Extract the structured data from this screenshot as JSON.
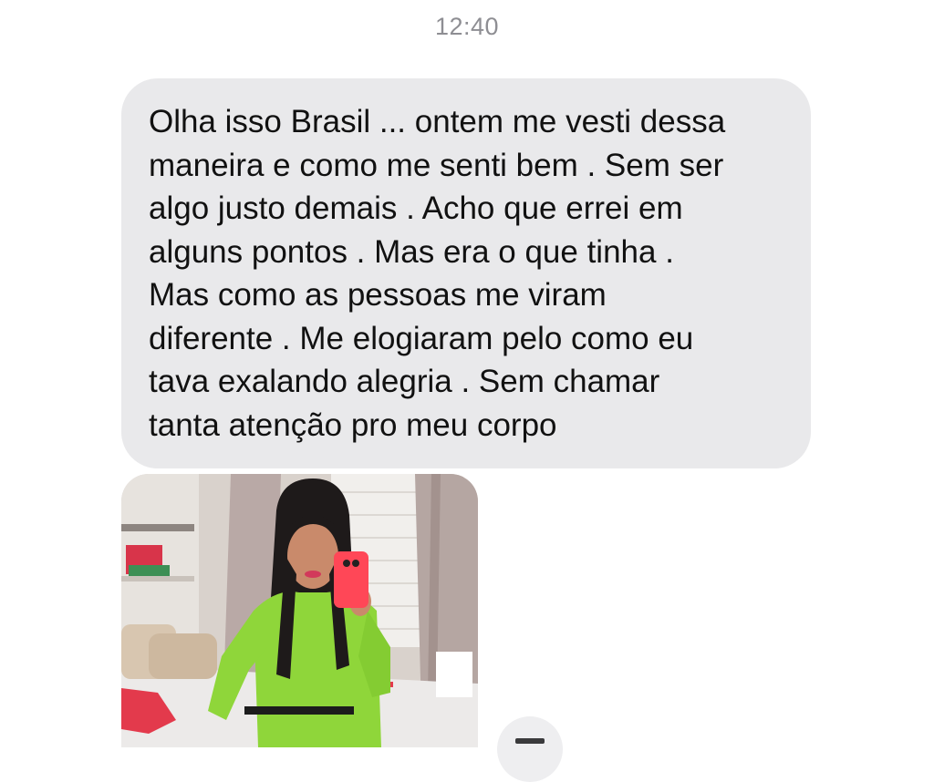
{
  "conversation": {
    "timestamp": "12:40",
    "message": {
      "lines": [
        "Olha isso Brasil ... ontem me vesti dessa",
        "maneira e como me senti bem . Sem ser",
        "algo justo demais . Acho que errei em",
        "alguns pontos . Mas era o que tinha .",
        "Mas como as pessoas me viram",
        "diferente . Me elogiaram pelo como eu",
        "tava exalando alegria . Sem chamar",
        "tanta atenção pro meu corpo"
      ],
      "bubble_color": "#e9e9eb",
      "text_color": "#111111"
    },
    "attachment": {
      "type": "photo",
      "outfit_color": "#8fd63a",
      "phone_case_color": "#ff4757",
      "reaction_icon": "share-icon"
    }
  }
}
